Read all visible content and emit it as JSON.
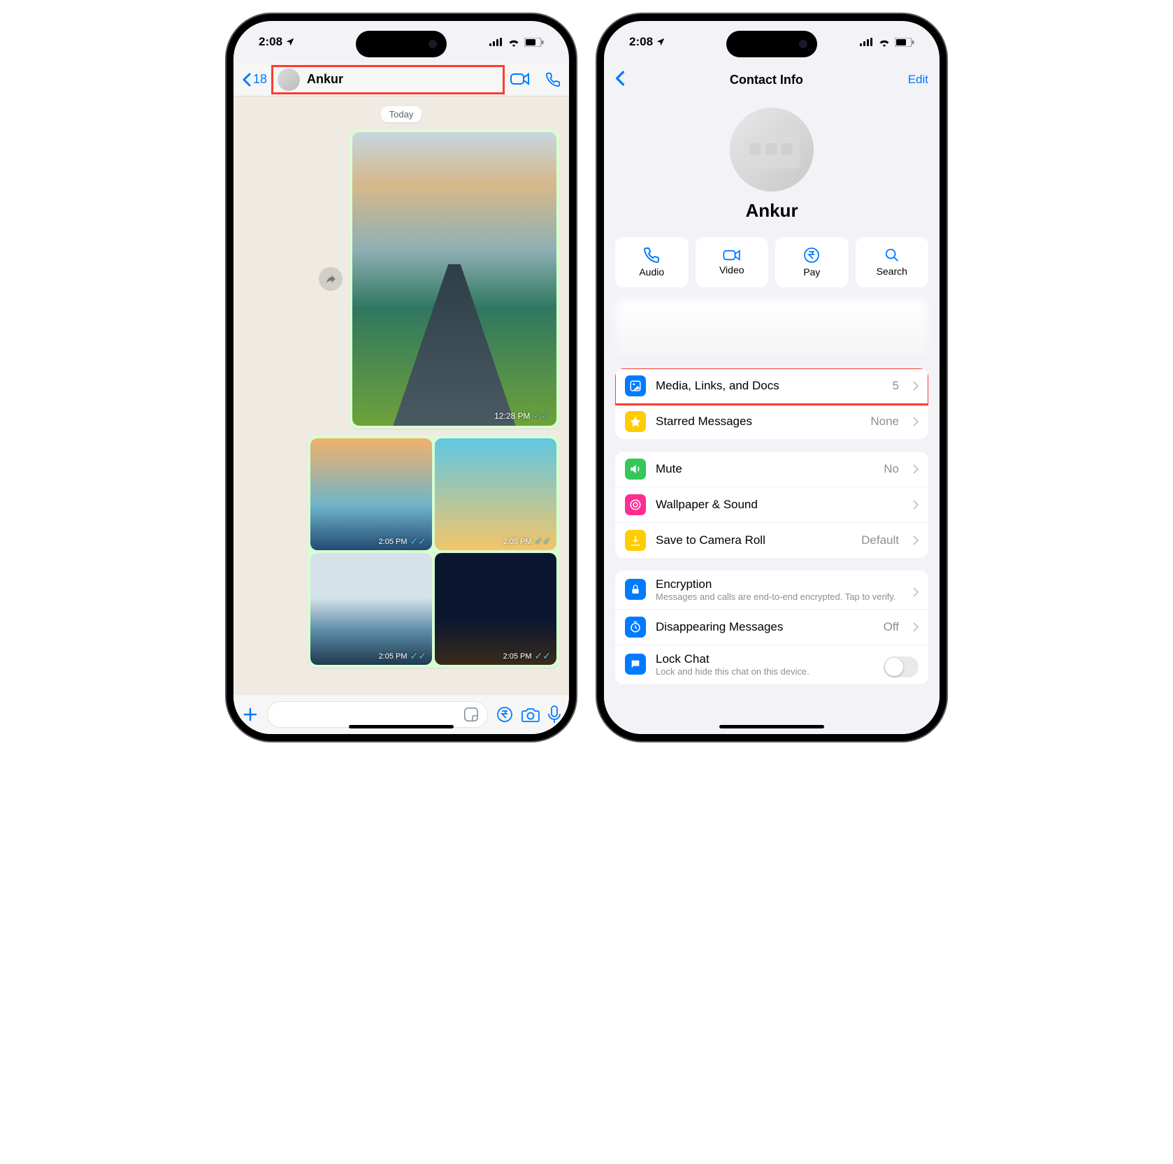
{
  "status": {
    "time": "2:08"
  },
  "phone1": {
    "header": {
      "back_count": "18",
      "contact_name": "Ankur"
    },
    "chat": {
      "day_label": "Today",
      "msg1_time": "12:28 PM",
      "grid": [
        {
          "time": "2:05 PM"
        },
        {
          "time": "2:05 PM"
        },
        {
          "time": "2:05 PM"
        },
        {
          "time": "2:05 PM"
        }
      ]
    }
  },
  "phone2": {
    "header": {
      "title": "Contact Info",
      "edit": "Edit"
    },
    "profile": {
      "name": "Ankur"
    },
    "actions": {
      "audio": "Audio",
      "video": "Video",
      "pay": "Pay",
      "search": "Search"
    },
    "rows": {
      "media": {
        "label": "Media, Links, and Docs",
        "value": "5"
      },
      "starred": {
        "label": "Starred Messages",
        "value": "None"
      },
      "mute": {
        "label": "Mute",
        "value": "No"
      },
      "wall": {
        "label": "Wallpaper & Sound"
      },
      "save": {
        "label": "Save to Camera Roll",
        "value": "Default"
      },
      "enc": {
        "label": "Encryption",
        "sub": "Messages and calls are end-to-end encrypted. Tap to verify."
      },
      "dis": {
        "label": "Disappearing Messages",
        "value": "Off"
      },
      "lock": {
        "label": "Lock Chat",
        "sub": "Lock and hide this chat on this device."
      }
    }
  }
}
